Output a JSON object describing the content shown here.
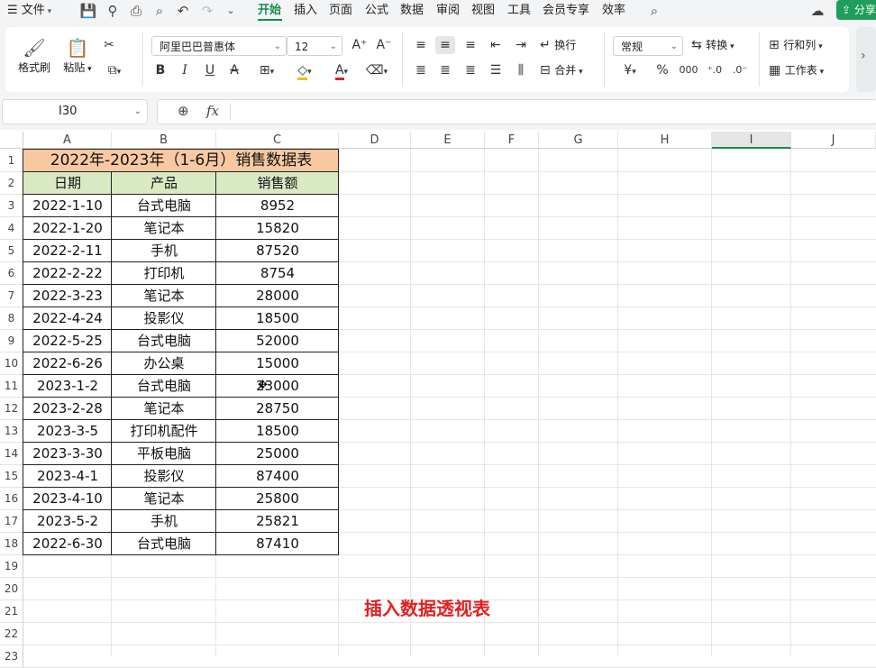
{
  "menubar": {
    "file_label": "文件",
    "tabs": [
      {
        "label": "开始"
      },
      {
        "label": "插入"
      },
      {
        "label": "页面"
      },
      {
        "label": "公式"
      },
      {
        "label": "数据"
      },
      {
        "label": "审阅"
      },
      {
        "label": "视图"
      },
      {
        "label": "工具"
      },
      {
        "label": "会员专享"
      },
      {
        "label": "效率"
      }
    ],
    "share_label": "分享"
  },
  "ribbon": {
    "format_painter": "格式刷",
    "paste": "粘贴",
    "font_name": "阿里巴巴普惠体",
    "font_size": "12",
    "wrap": "换行",
    "merge": "合并",
    "number_format": "常规",
    "convert": "转换",
    "rows_cols": "行和列",
    "worksheet": "工作表",
    "currency_symbol": "¥",
    "percent_symbol": "%",
    "thousands_symbol": "000"
  },
  "formula_bar": {
    "name_box": "I30",
    "fx_label": "fx",
    "content": ""
  },
  "columns": [
    "A",
    "B",
    "C",
    "D",
    "E",
    "F",
    "G",
    "H",
    "I",
    "J"
  ],
  "rows": [
    "1",
    "2",
    "3",
    "4",
    "5",
    "6",
    "7",
    "8",
    "9",
    "10",
    "11",
    "12",
    "13",
    "14",
    "15",
    "16",
    "17",
    "18",
    "19",
    "20",
    "21",
    "22",
    "23"
  ],
  "table": {
    "title": "2022年-2023年（1-6月）销售数据表",
    "headers": [
      "日期",
      "产品",
      "销售额"
    ],
    "title_color": "#f8c9a0",
    "header_color": "#d9e9c4",
    "rows": [
      [
        "2022-1-10",
        "台式电脑",
        "8952"
      ],
      [
        "2022-1-20",
        "笔记本",
        "15820"
      ],
      [
        "2022-2-11",
        "手机",
        "87520"
      ],
      [
        "2022-2-22",
        "打印机",
        "8754"
      ],
      [
        "2022-3-23",
        "笔记本",
        "28000"
      ],
      [
        "2022-4-24",
        "投影仪",
        "18500"
      ],
      [
        "2022-5-25",
        "台式电脑",
        "52000"
      ],
      [
        "2022-6-26",
        "办公桌",
        "15000"
      ],
      [
        "2023-1-2",
        "台式电脑",
        "23000"
      ],
      [
        "2023-2-28",
        "笔记本",
        "28750"
      ],
      [
        "2023-3-5",
        "打印机配件",
        "18500"
      ],
      [
        "2023-3-30",
        "平板电脑",
        "25000"
      ],
      [
        "2023-4-1",
        "投影仪",
        "87400"
      ],
      [
        "2023-4-10",
        "笔记本",
        "25800"
      ],
      [
        "2023-5-2",
        "手机",
        "25821"
      ],
      [
        "2022-6-30",
        "台式电脑",
        "87410"
      ]
    ]
  },
  "caption": "插入数据透视表",
  "selected_column": "I",
  "accent_color": "#1a8a4a",
  "caption_color": "#e02020"
}
